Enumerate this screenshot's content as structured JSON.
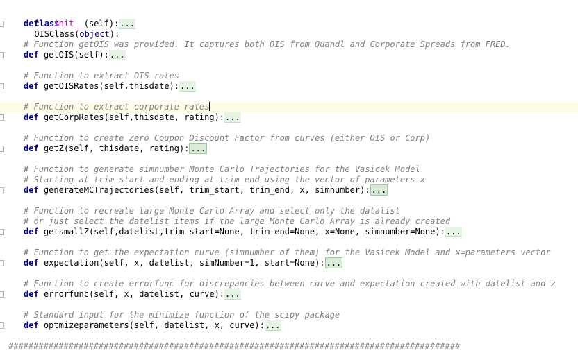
{
  "class_def": {
    "keyword": "class",
    "name": "OISClass",
    "base": "object",
    "colon": ":"
  },
  "lines": [
    {
      "type": "def",
      "name": "__init__",
      "args": "(self)",
      "fold": "..."
    },
    {
      "type": "blank"
    },
    {
      "type": "comment",
      "text": "# Function getOIS was provided. It captures both OIS from Quandl and Corporate Spreads from FRED."
    },
    {
      "type": "def",
      "name": "getOIS",
      "args": "(self)",
      "fold": "..."
    },
    {
      "type": "blank"
    },
    {
      "type": "comment",
      "text": "# Function to extract OIS rates"
    },
    {
      "type": "def",
      "name": "getOISRates",
      "args": "(self,thisdate)",
      "fold": "..."
    },
    {
      "type": "blank"
    },
    {
      "type": "comment",
      "text": "# Function to extract corporate rates",
      "current": true
    },
    {
      "type": "def",
      "name": "getCorpRates",
      "args": "(self,thisdate, rating)",
      "fold": "..."
    },
    {
      "type": "blank"
    },
    {
      "type": "comment",
      "text": "# Function to create Zero Coupon Discount Factor from curves (either OIS or Corp)"
    },
    {
      "type": "def",
      "name": "getZ",
      "args": "(self, thisdate, rating)",
      "fold": "...",
      "boxed": true
    },
    {
      "type": "blank"
    },
    {
      "type": "comment",
      "text": "# Function to generate simnumber Monte Carlo Trajectories for the Vasicek Model"
    },
    {
      "type": "comment",
      "text": "# Starting at trim_start and ending at trim_end using the vector of parameters x"
    },
    {
      "type": "def",
      "name": "generateMCTrajectories",
      "args": "(self, trim_start, trim_end, x, simnumber)",
      "fold": "...",
      "boxed": true
    },
    {
      "type": "blank"
    },
    {
      "type": "comment",
      "text": "# Function to recreate large Monte Carlo Array and select only the datalist"
    },
    {
      "type": "comment",
      "text": "# or just select the datelist items if the large Monte Carlo Array is already created"
    },
    {
      "type": "def",
      "name": "getsmallZ",
      "args": "(self,datelist,trim_start=None, trim_end=None, x=None, simnumber=None)",
      "fold": "..."
    },
    {
      "type": "blank"
    },
    {
      "type": "comment",
      "text": "# Function to get the expectation curve (simnumber of them) for the Vasicek Model and x=parameters vector"
    },
    {
      "type": "def",
      "name": "expectation",
      "args": "(self, x, datelist, simNumber=1, start=None)",
      "fold": "...",
      "boxed": true
    },
    {
      "type": "blank"
    },
    {
      "type": "comment",
      "text": "# Function to create errorfunc for discrepancies between curve and expectation created with datelist and z"
    },
    {
      "type": "def",
      "name": "errorfunc",
      "args": "(self, x, datelist, curve)",
      "fold": "..."
    },
    {
      "type": "blank"
    },
    {
      "type": "comment",
      "text": "# Standard input for the minimize function of the scipy package"
    },
    {
      "type": "def",
      "name": "optmizeparameters",
      "args": "(self, datelist, x, curve)",
      "fold": "..."
    },
    {
      "type": "blank"
    },
    {
      "type": "separator",
      "text": "##########################################################################################"
    }
  ],
  "colors": {
    "keyword": "#000080",
    "comment": "#808080",
    "magic": "#b200b2",
    "current_line": "#fdfbe6",
    "fold_placeholder": "#e4f3e4"
  }
}
